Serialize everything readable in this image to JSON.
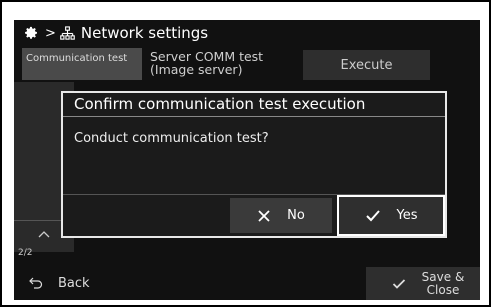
{
  "header": {
    "title": "Network settings",
    "separator": ">",
    "settings_icon": "gear-icon",
    "network_icon": "network-icon"
  },
  "row": {
    "tab_label": "Communication test",
    "server_label_line1": "Server COMM test",
    "server_label_line2": "(Image server)",
    "execute_label": "Execute"
  },
  "sidebar": {
    "page_indicator": "2/2",
    "up_icon": "chevron-up-icon"
  },
  "dialog": {
    "title": "Confirm communication test execution",
    "message": "Conduct communication test?",
    "no_label": "No",
    "yes_label": "Yes"
  },
  "footer": {
    "back_label": "Back",
    "save_line1": "Save &",
    "save_line2": "Close"
  },
  "colors": {
    "background": "#111111",
    "panel": "#2a2a2a",
    "text": "#ffffff",
    "selected_border": "#ffffff"
  }
}
